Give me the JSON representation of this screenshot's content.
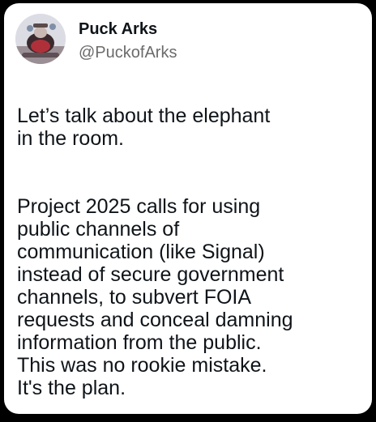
{
  "post": {
    "author": {
      "display_name": "Puck Arks",
      "handle": "@PuckofArks",
      "avatar_icon": "profile-avatar"
    },
    "paragraphs": [
      "Let’s talk about the elephant\nin the room.",
      "Project 2025 calls for using\npublic channels of\ncommunication (like Signal)\ninstead of secure government\nchannels, to subvert FOIA\nrequests and conceal damning\ninformation from the public.\nThis was no rookie mistake.\nIt's the plan."
    ]
  },
  "colors": {
    "background": "#000000",
    "card": "#ffffff",
    "text": "#0f1419",
    "handle": "#6b6b6b"
  }
}
